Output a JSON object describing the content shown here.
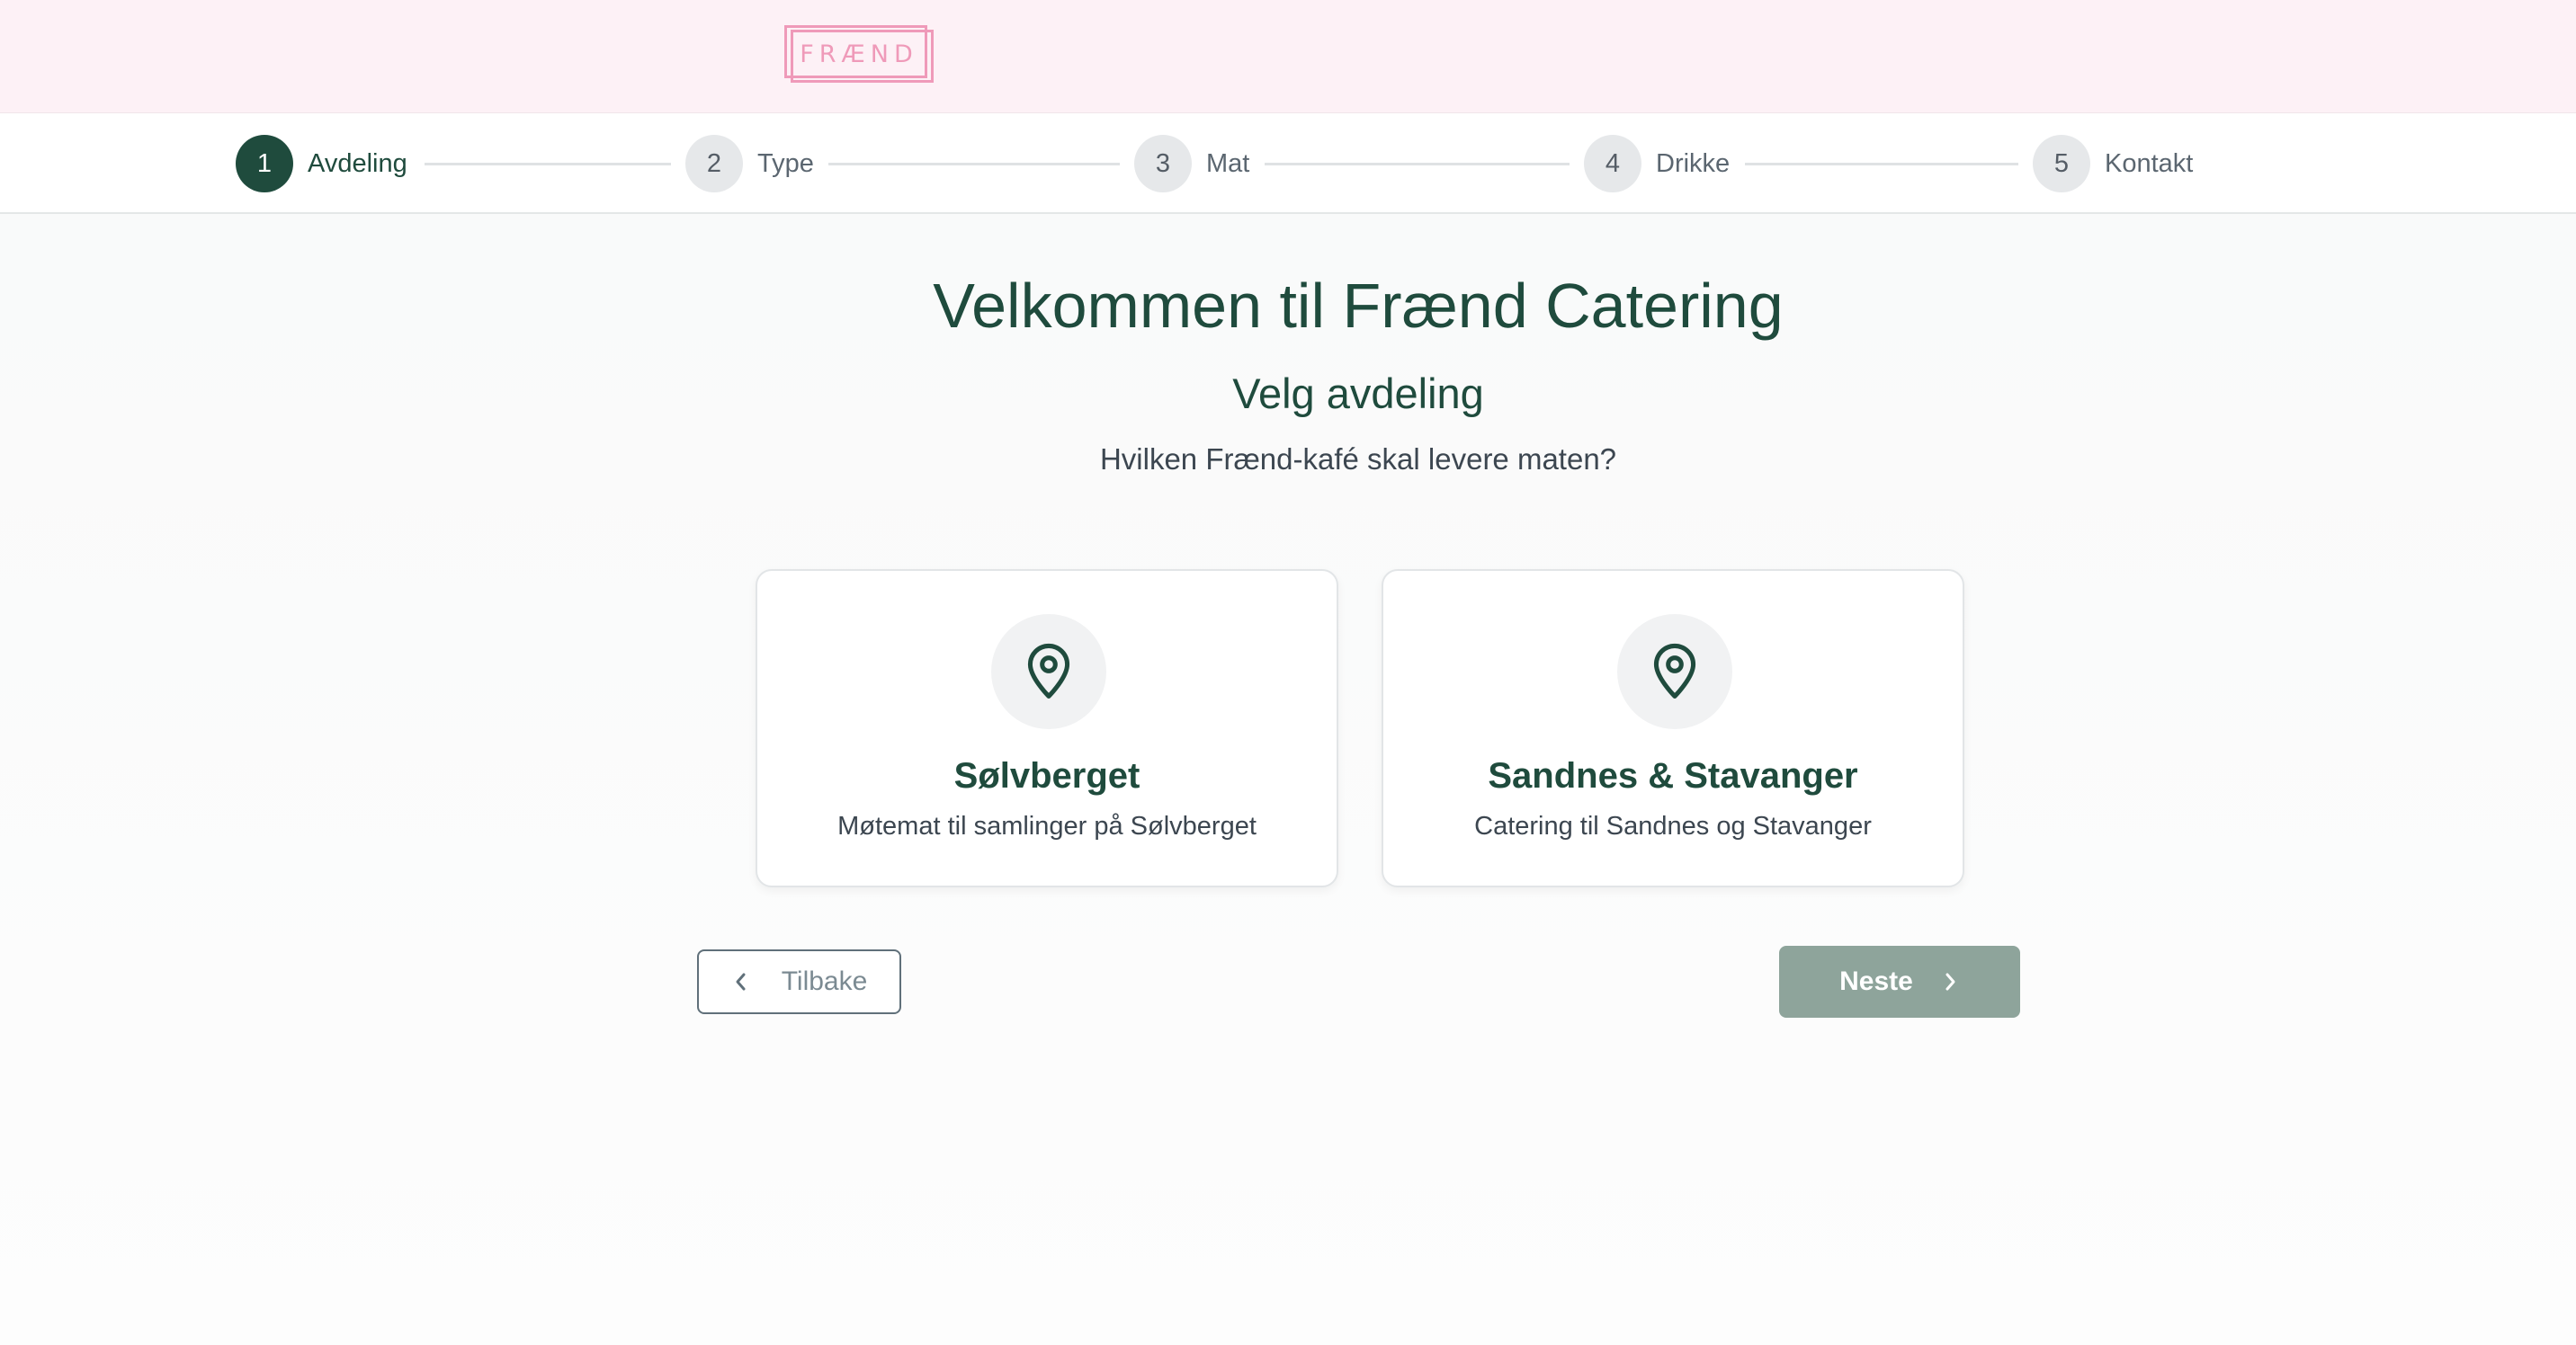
{
  "header": {
    "logo_text": "FRÆND",
    "logo_color": "#ef9ab9",
    "background": "#fdf1f6"
  },
  "stepper": {
    "current": 1,
    "steps": [
      {
        "number": "1",
        "label": "Avdeling"
      },
      {
        "number": "2",
        "label": "Type"
      },
      {
        "number": "3",
        "label": "Mat"
      },
      {
        "number": "4",
        "label": "Drikke"
      },
      {
        "number": "5",
        "label": "Kontakt"
      }
    ]
  },
  "main": {
    "title": "Velkommen til Frænd Catering",
    "subtitle": "Velg avdeling",
    "question": "Hvilken Frænd-kafé skal levere maten?",
    "options": [
      {
        "icon": "map-pin-icon",
        "title": "Sølvberget",
        "description": "Møtemat til samlinger på Sølvberget"
      },
      {
        "icon": "map-pin-icon",
        "title": "Sandnes & Stavanger",
        "description": "Catering til Sandnes og Stavanger"
      }
    ]
  },
  "navigation": {
    "back_label": "Tilbake",
    "next_label": "Neste"
  },
  "colors": {
    "primary": "#1f4b3d",
    "next_button": "#8ea49b"
  }
}
